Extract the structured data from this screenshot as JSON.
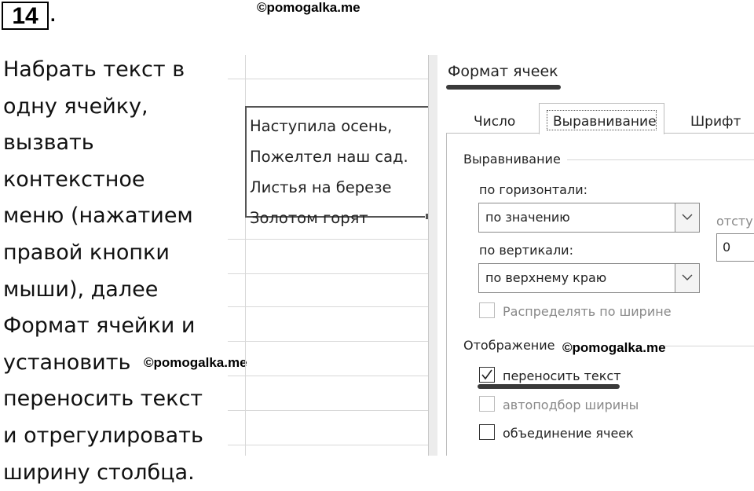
{
  "task": {
    "number": "14",
    "dot": "."
  },
  "watermarks": {
    "top": "©pomogalka.me",
    "middle_left": "©pomogalka.me",
    "dialog": "©pomogalka.me"
  },
  "instruction_lines": [
    "Набрать текст в",
    "одну ячейку,",
    "вызвать",
    "контекстное",
    "меню (нажатием",
    "правой кнопки",
    "мыши), далее",
    "Формат ячейки и",
    "установить",
    "переносить текст",
    "и отрегулировать",
    "ширину столбца."
  ],
  "cell": {
    "lines": [
      "Наступила осень,",
      "Пожелтел наш сад.",
      "Листья на березе",
      "Золотом горят"
    ]
  },
  "dialog": {
    "title": "Формат ячеек",
    "tabs": [
      {
        "label": "Число",
        "active": false
      },
      {
        "label": "Выравнивание",
        "active": true
      },
      {
        "label": "Шрифт",
        "active": false
      }
    ],
    "alignment_group": "Выравнивание",
    "horizontal_label": "по горизонтали:",
    "horizontal_value": "по значению",
    "indent_label": "отступ",
    "indent_value": "0",
    "vertical_label": "по вертикали:",
    "vertical_value": "по верхнему краю",
    "distribute_label": "Распределять по ширине",
    "display_group": "Отображение",
    "wrap_text": {
      "label": "переносить текст",
      "checked": true
    },
    "shrink_to_fit": {
      "label": "автоподбор ширины",
      "checked": false,
      "enabled": false
    },
    "merge_cells": {
      "label": "объединение ячеек",
      "checked": false
    }
  }
}
